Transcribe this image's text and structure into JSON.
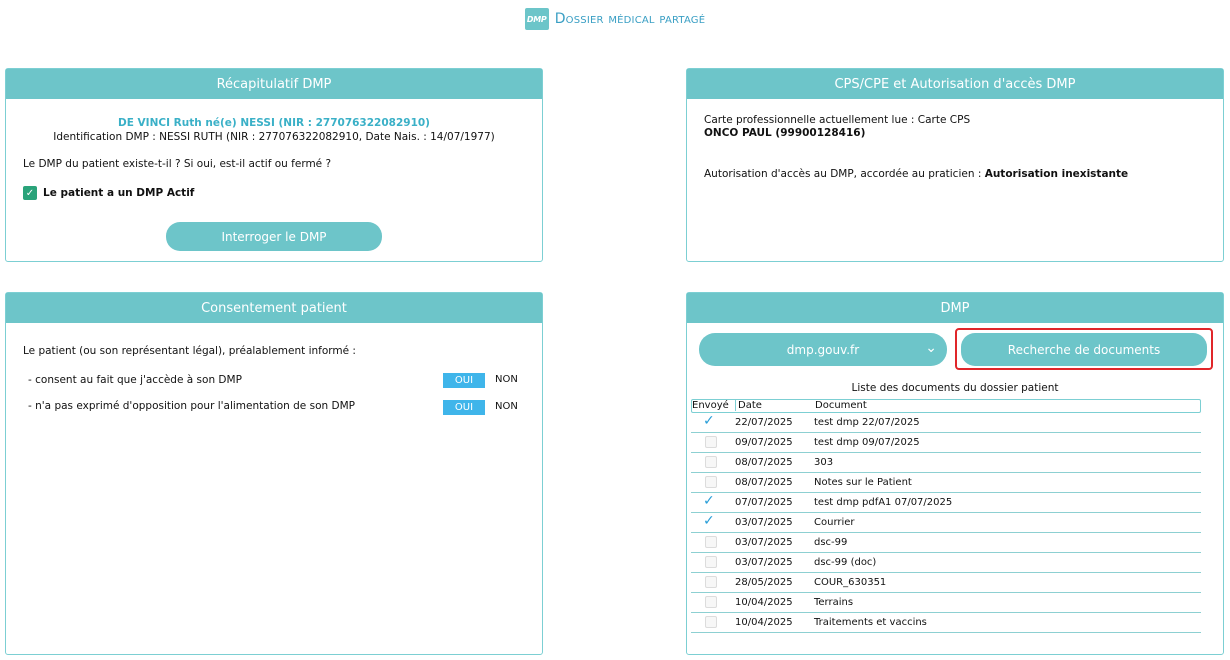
{
  "app": {
    "logo_text": "DMP",
    "title": "Dossier médical partagé"
  },
  "recap": {
    "header": "Récapitulatif DMP",
    "patient_line": "DE VINCI Ruth né(e) NESSI (NIR : 277076322082910)",
    "identification": "Identification DMP : NESSI RUTH (NIR : 277076322082910, Date Nais. : 14/07/1977)",
    "question": "Le DMP du patient existe-t-il ? Si oui, est-il actif ou fermé ?",
    "status": "Le patient a un DMP Actif",
    "button": "Interroger le DMP"
  },
  "cps": {
    "header": "CPS/CPE et Autorisation d'accès  DMP",
    "card_line": "Carte professionnelle actuellement lue :  Carte CPS",
    "practitioner": "ONCO PAUL (99900128416)",
    "auth_prefix": "Autorisation d'accès au DMP, accordée au praticien : ",
    "auth_value": "Autorisation inexistante"
  },
  "consent": {
    "header": "Consentement patient",
    "intro": "Le patient (ou son représentant légal), préalablement informé :",
    "items": [
      {
        "text": "- consent au fait que j'accède à son DMP",
        "oui": "OUI",
        "non": "NON"
      },
      {
        "text": "- n'a pas exprimé d'opposition pour l'alimentation de son DMP",
        "oui": "OUI",
        "non": "NON"
      }
    ]
  },
  "dmp": {
    "header": "DMP",
    "select_value": "dmp.gouv.fr",
    "search_button": "Recherche de documents",
    "list_title": "Liste des documents du dossier patient",
    "columns": {
      "sent": "Envoyé",
      "date": "Date",
      "document": "Document"
    },
    "rows": [
      {
        "sent": true,
        "date": "22/07/2025",
        "document": "test dmp 22/07/2025"
      },
      {
        "sent": false,
        "date": "09/07/2025",
        "document": "test dmp 09/07/2025"
      },
      {
        "sent": false,
        "date": "08/07/2025",
        "document": "303"
      },
      {
        "sent": false,
        "date": "08/07/2025",
        "document": "Notes sur le Patient"
      },
      {
        "sent": true,
        "date": "07/07/2025",
        "document": "test dmp pdfA1 07/07/2025"
      },
      {
        "sent": true,
        "date": "03/07/2025",
        "document": "Courrier"
      },
      {
        "sent": false,
        "date": "03/07/2025",
        "document": "dsc-99"
      },
      {
        "sent": false,
        "date": "03/07/2025",
        "document": "dsc-99 (doc)"
      },
      {
        "sent": false,
        "date": "28/05/2025",
        "document": "COUR_630351"
      },
      {
        "sent": false,
        "date": "10/04/2025",
        "document": "Terrains"
      },
      {
        "sent": false,
        "date": "10/04/2025",
        "document": "Traitements et vaccins"
      }
    ]
  },
  "colors": {
    "accent": "#6dc5c9",
    "title": "#3a9fc4",
    "oui": "#3fb5ea",
    "highlight": "#e0262a"
  },
  "icons": {
    "check": "check-icon",
    "status": "checkbox-checked-icon",
    "chevron": "chevron-down-icon"
  }
}
